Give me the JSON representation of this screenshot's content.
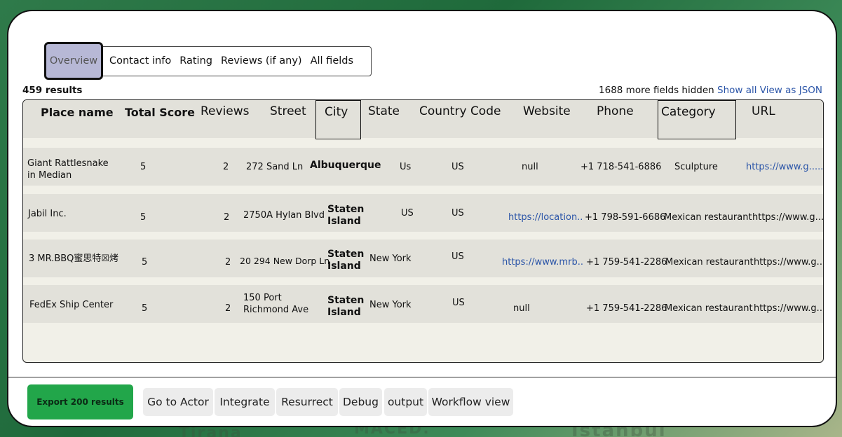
{
  "tabs": {
    "active": "Overview",
    "items": [
      "Contact info",
      "Rating",
      "Reviews (if any)",
      "All fields"
    ]
  },
  "summary": {
    "results": "459 results",
    "hidden": "1688 more fields hidden",
    "show_all": "Show all",
    "view_json": "View as JSON"
  },
  "table": {
    "headers": {
      "place_name": "Place name",
      "total_score": "Total Score",
      "reviews": "Reviews",
      "street": "Street",
      "city": "City",
      "state": "State",
      "country_code": "Country Code",
      "website": "Website",
      "phone": "Phone",
      "category": "Category",
      "url": "URL"
    },
    "rows": [
      {
        "place_name": "Giant Rattlesnake in Median",
        "total_score": "5",
        "reviews": "2",
        "street": "272 Sand Ln",
        "city": "Albuquerque",
        "state": "Us",
        "country_code": "US",
        "website": "null",
        "phone": "+1 718-541-6886",
        "category": "Sculpture",
        "url": "https://www.g......"
      },
      {
        "place_name": "Jabil Inc.",
        "total_score": "5",
        "reviews": "2",
        "street": "2750A Hylan Blvd",
        "city": "Staten Island",
        "state": "US",
        "country_code": "US",
        "website": "https://location..",
        "phone": "+1 798-591-6686",
        "category": "Mexican restaurant",
        "url": "https://www.g..."
      },
      {
        "place_name": "3 MR.BBQ蜜思特☒烤",
        "total_score": "5",
        "reviews": "2",
        "street": "20 294 New Dorp Ln",
        "city": "Staten Island",
        "state": "New York",
        "country_code": "US",
        "website": "https://www.mrb..",
        "phone": "+1 759-541-2286",
        "category": "Mexican restaurant",
        "url": "https://www.g..."
      },
      {
        "place_name": "FedEx Ship Center",
        "total_score": "5",
        "reviews": "2",
        "street": "150 Port Richmond Ave",
        "city": "Staten Island",
        "state": "New York",
        "country_code": "US",
        "website": "null",
        "phone": "+1 759-541-2286",
        "category": "Mexican restaurant",
        "url": "https://www.g..."
      }
    ]
  },
  "actions": {
    "export": "Export 200 results",
    "go_to_actor": "Go to Actor",
    "integrate": "Integrate",
    "resurrect": "Resurrect",
    "debug": "Debug",
    "output": "output",
    "workflow_view": "Workflow view"
  },
  "background": {
    "label_1": "Tirana",
    "label_2": "MACED.",
    "label_3": "Istanbul"
  },
  "colors": {
    "accent_green": "#22a64a",
    "link_blue": "#2b55a8",
    "active_tab": "#b7b8d6"
  }
}
